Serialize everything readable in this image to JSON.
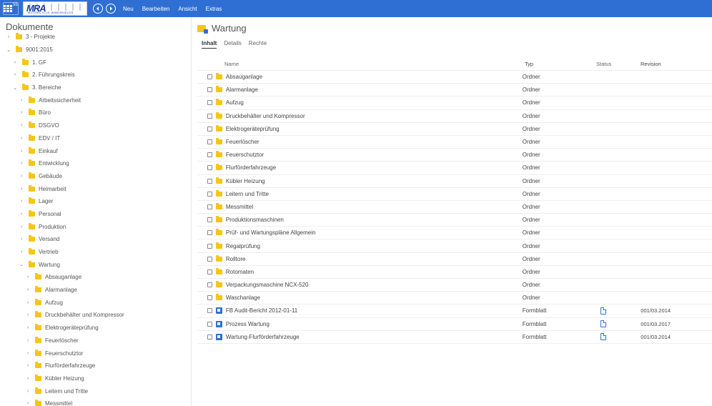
{
  "topbar": {
    "app_badge": "55",
    "logo_text": "MRA",
    "logo_subtext": "MOTORCYCLE WINDSHIELDS",
    "nav_back_icon": "arrow-left-icon",
    "nav_forward_icon": "arrow-right-icon",
    "menu": [
      "Neu",
      "Bearbeiten",
      "Ansicht",
      "Extras"
    ]
  },
  "sidebar": {
    "title": "Dokumente",
    "tree": [
      {
        "label": "3 - Projekte",
        "expanded": false,
        "level": 0
      },
      {
        "label": "9001:2015",
        "expanded": true,
        "level": 0
      },
      {
        "label": "1. GF",
        "expanded": false,
        "level": 1
      },
      {
        "label": "2. Führungskreis",
        "expanded": false,
        "level": 1
      },
      {
        "label": "3. Bereiche",
        "expanded": true,
        "level": 1
      },
      {
        "label": "Arbeitssicherheit",
        "expanded": false,
        "level": 2
      },
      {
        "label": "Büro",
        "expanded": false,
        "level": 2
      },
      {
        "label": "DSGVO",
        "expanded": false,
        "level": 2
      },
      {
        "label": "EDV / IT",
        "expanded": false,
        "level": 2
      },
      {
        "label": "Einkauf",
        "expanded": false,
        "level": 2
      },
      {
        "label": "Entwicklung",
        "expanded": false,
        "level": 2
      },
      {
        "label": "Gebäude",
        "expanded": false,
        "level": 2
      },
      {
        "label": "Heimarbeit",
        "expanded": false,
        "level": 2
      },
      {
        "label": "Lager",
        "expanded": false,
        "level": 2
      },
      {
        "label": "Personal",
        "expanded": false,
        "level": 2
      },
      {
        "label": "Produktion",
        "expanded": false,
        "level": 2
      },
      {
        "label": "Versand",
        "expanded": false,
        "level": 2
      },
      {
        "label": "Vertrieb",
        "expanded": false,
        "level": 2
      },
      {
        "label": "Wartung",
        "expanded": true,
        "level": 2
      },
      {
        "label": "Absauganlage",
        "expanded": false,
        "level": 3
      },
      {
        "label": "Alarmanlage",
        "expanded": false,
        "level": 3
      },
      {
        "label": "Aufzug",
        "expanded": false,
        "level": 3
      },
      {
        "label": "Druckbehälter und Kompressor",
        "expanded": false,
        "level": 3
      },
      {
        "label": "Elektrogeräteprüfung",
        "expanded": false,
        "level": 3
      },
      {
        "label": "Feuerlöscher",
        "expanded": false,
        "level": 3
      },
      {
        "label": "Feuerschutztor",
        "expanded": false,
        "level": 3
      },
      {
        "label": "Flurförderfahrzeuge",
        "expanded": false,
        "level": 3
      },
      {
        "label": "Kübler Heizung",
        "expanded": false,
        "level": 3
      },
      {
        "label": "Leitern und Tritte",
        "expanded": false,
        "level": 3
      },
      {
        "label": "Messmittel",
        "expanded": false,
        "level": 3
      }
    ]
  },
  "main": {
    "title": "Wartung",
    "tabs": [
      {
        "label": "Inhalt",
        "active": true
      },
      {
        "label": "Details",
        "active": false
      },
      {
        "label": "Rechte",
        "active": false
      }
    ],
    "columns": {
      "name": "Name",
      "typ": "Typ",
      "status": "Status",
      "revision": "Revision"
    },
    "rows": [
      {
        "name": "Absauganlage",
        "typ": "Ordner",
        "kind": "folder",
        "status": "",
        "revision": ""
      },
      {
        "name": "Alarmanlage",
        "typ": "Ordner",
        "kind": "folder",
        "status": "",
        "revision": ""
      },
      {
        "name": "Aufzug",
        "typ": "Ordner",
        "kind": "folder",
        "status": "",
        "revision": ""
      },
      {
        "name": "Druckbehälter und Kompressor",
        "typ": "Ordner",
        "kind": "folder",
        "status": "",
        "revision": ""
      },
      {
        "name": "Elektrogeräteprüfung",
        "typ": "Ordner",
        "kind": "folder",
        "status": "",
        "revision": ""
      },
      {
        "name": "Feuerlöscher",
        "typ": "Ordner",
        "kind": "folder",
        "status": "",
        "revision": ""
      },
      {
        "name": "Feuerschutztor",
        "typ": "Ordner",
        "kind": "folder",
        "status": "",
        "revision": ""
      },
      {
        "name": "Flurförderfahrzeuge",
        "typ": "Ordner",
        "kind": "folder",
        "status": "",
        "revision": ""
      },
      {
        "name": "Kübler Heizung",
        "typ": "Ordner",
        "kind": "folder",
        "status": "",
        "revision": ""
      },
      {
        "name": "Leitern und Tritte",
        "typ": "Ordner",
        "kind": "folder",
        "status": "",
        "revision": ""
      },
      {
        "name": "Messmittel",
        "typ": "Ordner",
        "kind": "folder",
        "status": "",
        "revision": ""
      },
      {
        "name": "Produktionsmaschinen",
        "typ": "Ordner",
        "kind": "folder",
        "status": "",
        "revision": ""
      },
      {
        "name": "Prüf- und Wartungspläne Allgemein",
        "typ": "Ordner",
        "kind": "folder",
        "status": "",
        "revision": ""
      },
      {
        "name": "Regalprüfung",
        "typ": "Ordner",
        "kind": "folder",
        "status": "",
        "revision": ""
      },
      {
        "name": "Rolltore",
        "typ": "Ordner",
        "kind": "folder",
        "status": "",
        "revision": ""
      },
      {
        "name": "Rotomaten",
        "typ": "Ordner",
        "kind": "folder",
        "status": "",
        "revision": ""
      },
      {
        "name": "Verpackungsmaschine NCX-520",
        "typ": "Ordner",
        "kind": "folder",
        "status": "",
        "revision": ""
      },
      {
        "name": "Waschanlage",
        "typ": "Ordner",
        "kind": "folder",
        "status": "",
        "revision": ""
      },
      {
        "name": "FB Audit-Bericht 2012-01-11",
        "typ": "Formblatt",
        "kind": "document",
        "status": "document-status-icon",
        "revision": "001/03.2014"
      },
      {
        "name": "Prozess Wartung",
        "typ": "Formblatt",
        "kind": "document",
        "status": "document-status-icon",
        "revision": "001/03.2017"
      },
      {
        "name": "Wartung-Flurförderfahrzeuge",
        "typ": "Formblatt",
        "kind": "document",
        "status": "document-status-icon",
        "revision": "001/03.2014"
      }
    ]
  },
  "colors": {
    "accent": "#2f6fd3",
    "folder": "#f5c518"
  }
}
